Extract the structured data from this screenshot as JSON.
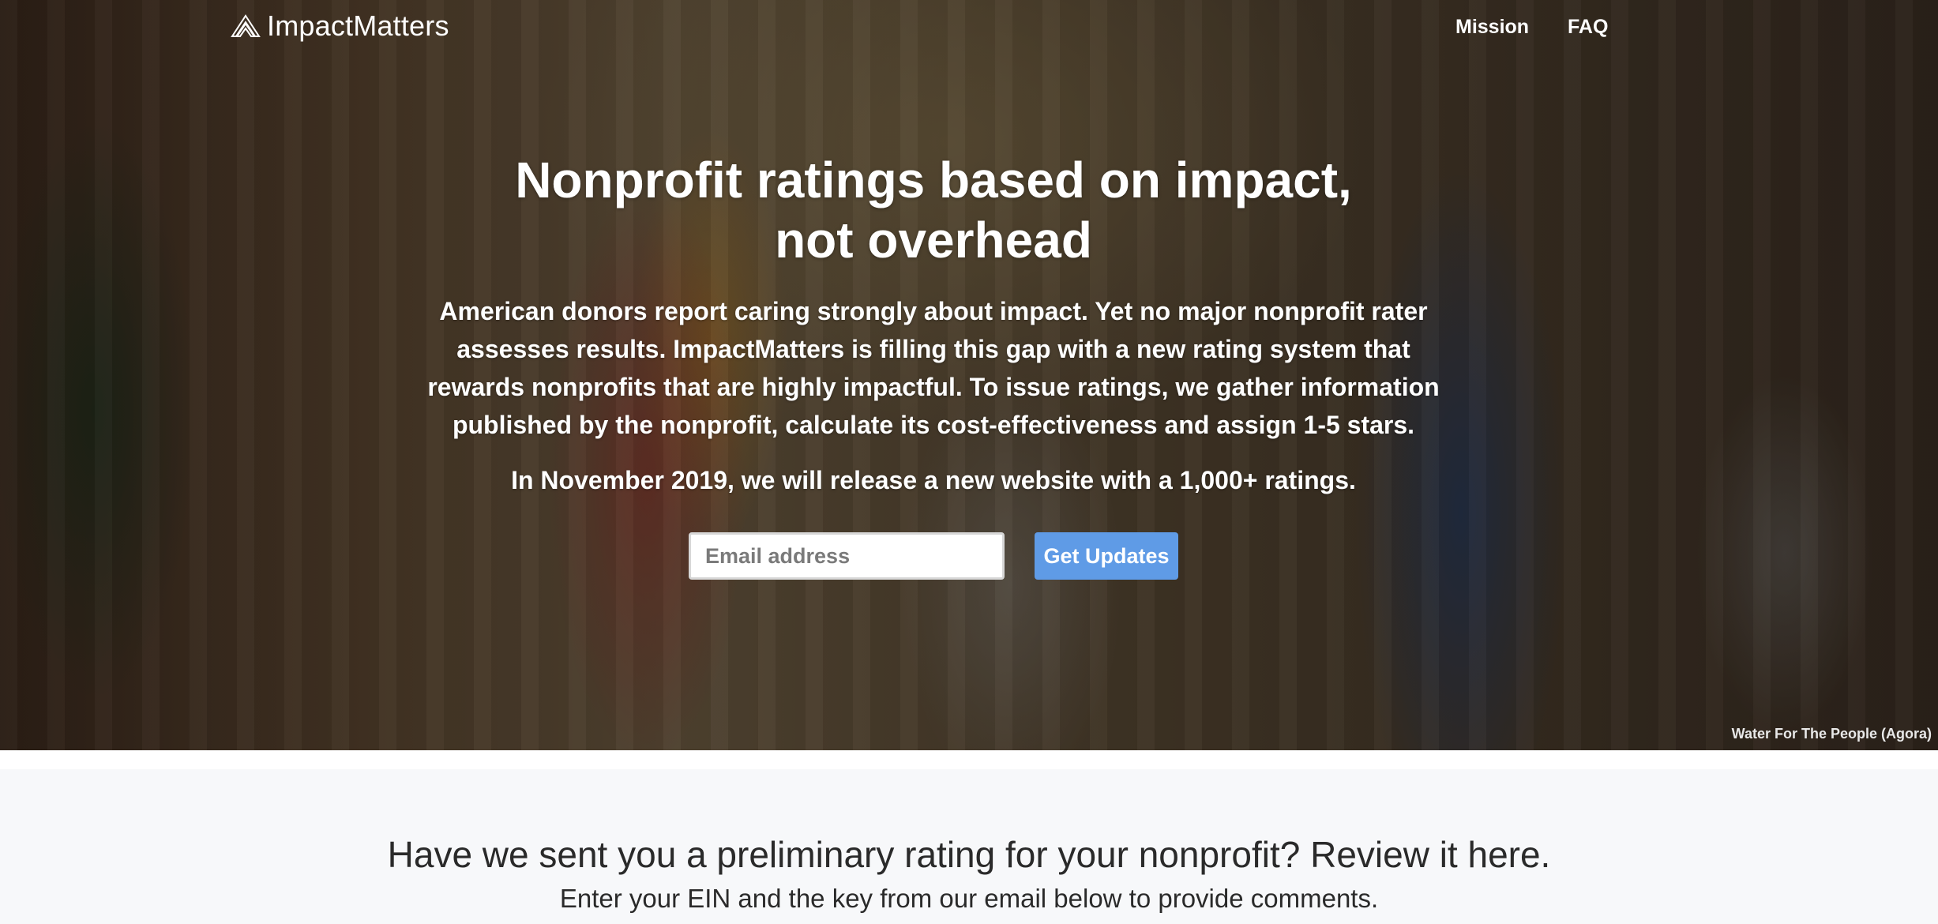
{
  "nav": {
    "brand": "ImpactMatters",
    "links": [
      {
        "label": "Mission"
      },
      {
        "label": "FAQ"
      }
    ]
  },
  "hero": {
    "title_line1": "Nonprofit ratings based on impact,",
    "title_line2": "not overhead",
    "description": "American donors report caring strongly about impact. Yet no major nonprofit rater assesses results. ImpactMatters is filling this gap with a new rating system that rewards nonprofits that are highly impactful. To issue ratings, we gather information published by the nonprofit, calculate its cost-effectiveness and assign 1-5 stars.",
    "announcement": "In November 2019, we will release a new website with a 1,000+ ratings.",
    "email_placeholder": "Email address",
    "submit_label": "Get Updates",
    "photo_credit": "Water For The People (Agora)",
    "button_color": "#5f9be6"
  },
  "review": {
    "heading": "Have we sent you a preliminary rating for your nonprofit? Review it here.",
    "subheading": "Enter your EIN and the key from our email below to provide comments."
  }
}
